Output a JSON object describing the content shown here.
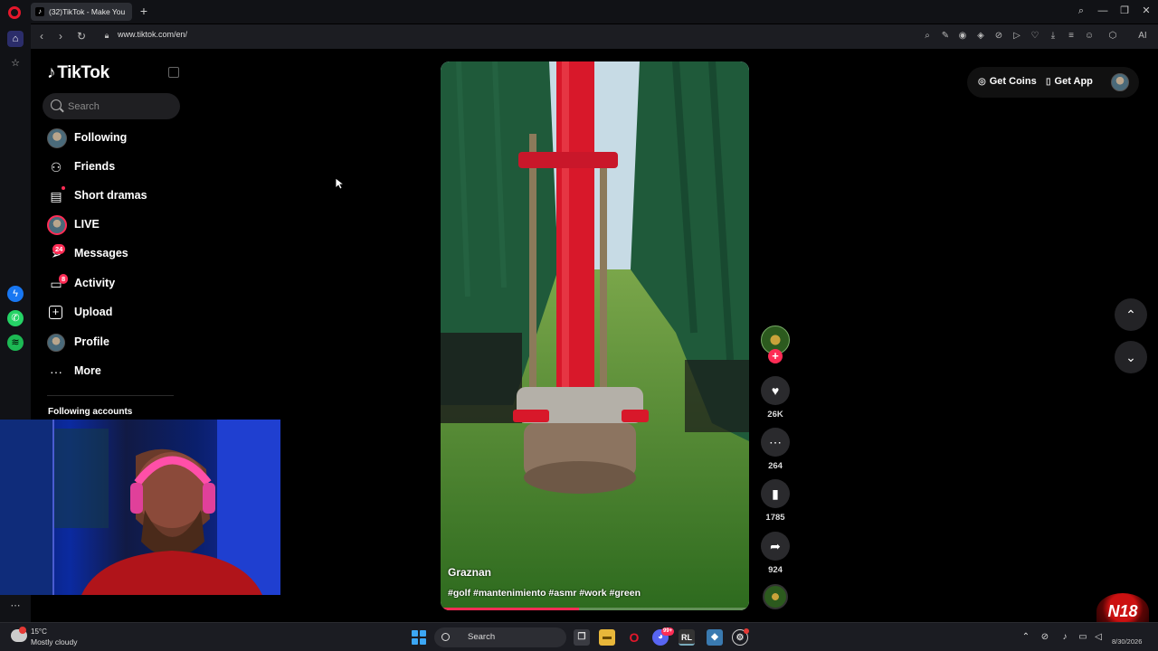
{
  "browser": {
    "tab_title": "(32)TikTok - Make You",
    "url": "www.tiktok.com/en/"
  },
  "tiktok": {
    "logo_text": "TikTok",
    "search_placeholder": "Search",
    "nav": [
      {
        "label": "Following"
      },
      {
        "label": "Friends"
      },
      {
        "label": "Short dramas"
      },
      {
        "label": "LIVE"
      },
      {
        "label": "Messages",
        "badge": "24"
      },
      {
        "label": "Activity",
        "badge": "8"
      },
      {
        "label": "Upload"
      },
      {
        "label": "Profile"
      },
      {
        "label": "More"
      }
    ],
    "following_accounts_label": "Following accounts",
    "video": {
      "author": "Graznan",
      "caption": "#golf #mantenimiento #asmr #work #green",
      "progress_fraction": 0.45
    },
    "actions": {
      "likes": "26K",
      "comments": "264",
      "saves": "1785",
      "shares": "924"
    },
    "top_right": {
      "get_coins": "Get Coins",
      "get_app": "Get App"
    }
  },
  "taskbar": {
    "weather_temp": "15°C",
    "weather_desc": "Mostly cloudy",
    "search_label": "Search",
    "date": "8/30/2026",
    "discord_badge": "99+"
  },
  "colors": {
    "tiktok_red": "#fe2c55",
    "background": "#000000"
  }
}
